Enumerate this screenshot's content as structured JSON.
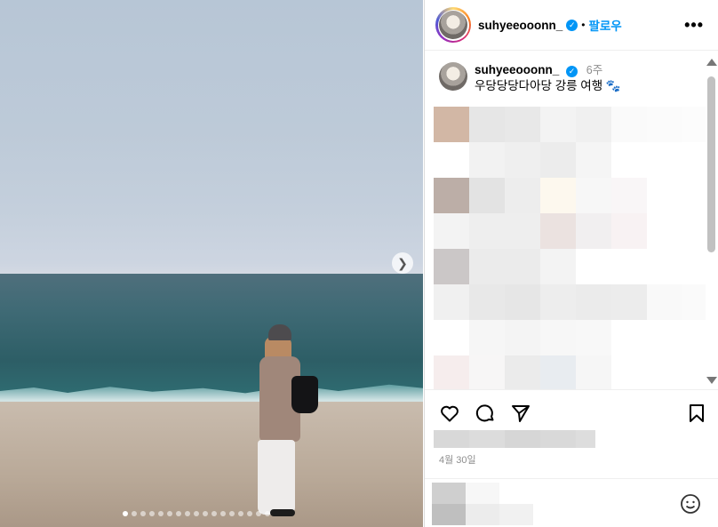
{
  "header": {
    "username": "suhyeeooonn_",
    "separator": "•",
    "follow_label": "팔로우",
    "more_label": "•••"
  },
  "caption": {
    "username": "suhyeeooonn_",
    "time": "6주",
    "text": "우당당당다아당 강릉 여행 🐾"
  },
  "post": {
    "date": "4월 30일",
    "carousel_slides": 17,
    "active_slide": 1
  },
  "icons": {
    "verified": "verified-badge-icon",
    "next": "chevron-right-icon",
    "like": "heart-icon",
    "comment": "comment-icon",
    "share": "send-icon",
    "save": "bookmark-icon",
    "emoji": "smiley-icon"
  },
  "colors": {
    "accent": "#0095f6",
    "muted": "#8e8e8e"
  }
}
